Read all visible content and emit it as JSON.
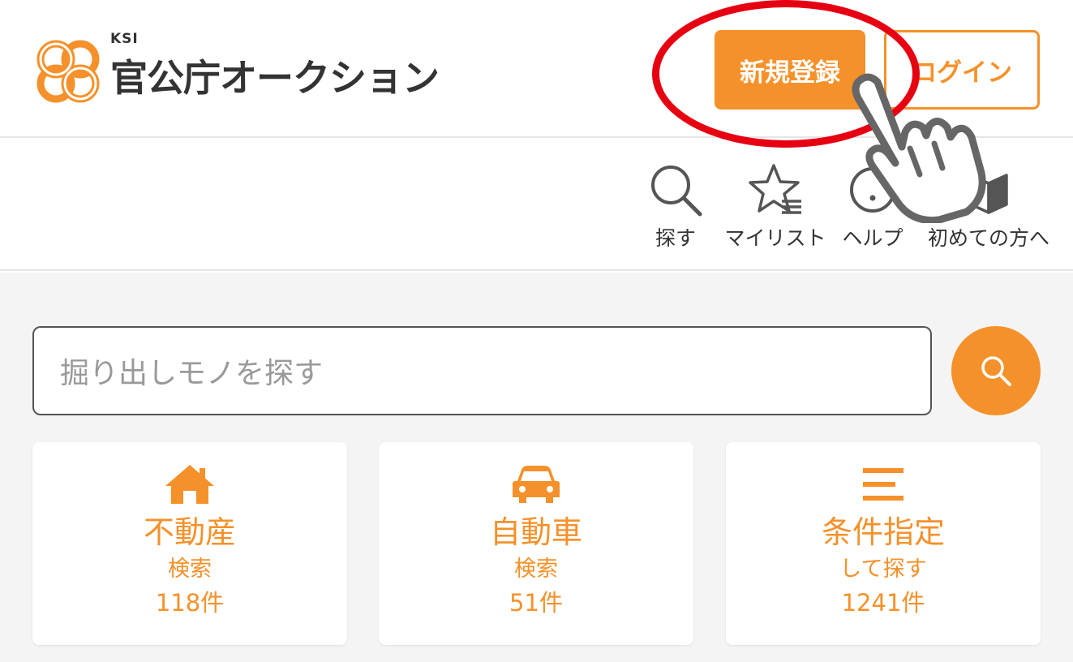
{
  "header": {
    "logo_ksi": "KSI",
    "logo_name": "官公庁オークション",
    "register_label": "新規登録",
    "login_label": "ログイン"
  },
  "subnav": {
    "items": [
      {
        "label": "探す",
        "icon": "search-icon"
      },
      {
        "label": "マイリスト",
        "icon": "star-list-icon"
      },
      {
        "label": "ヘルプ",
        "icon": "help-icon"
      },
      {
        "label": "初めての方へ",
        "icon": "book-icon"
      }
    ]
  },
  "search": {
    "placeholder": "掘り出しモノを探す"
  },
  "categories": [
    {
      "title": "不動産",
      "sub": "検索",
      "count": "118件",
      "icon": "house-icon"
    },
    {
      "title": "自動車",
      "sub": "検索",
      "count": "51件",
      "icon": "car-icon"
    },
    {
      "title": "条件指定",
      "sub": "して探す",
      "count": "1241件",
      "icon": "menu-lines-icon"
    }
  ],
  "colors": {
    "accent": "#f5912a",
    "highlight": "#e60012",
    "text": "#333333",
    "background": "#f4f4f4"
  }
}
